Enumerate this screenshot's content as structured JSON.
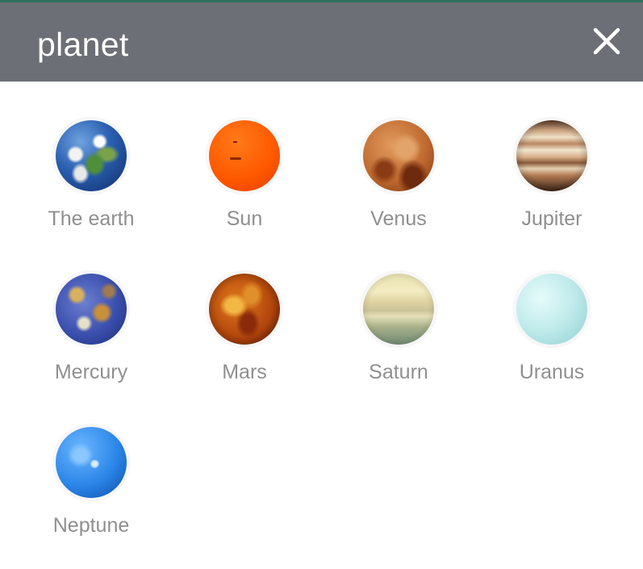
{
  "dialog": {
    "title": "planet",
    "close_icon": "close-icon"
  },
  "planets": [
    {
      "label": "The earth",
      "icon": "earth-icon"
    },
    {
      "label": "Sun",
      "icon": "sun-icon"
    },
    {
      "label": "Venus",
      "icon": "venus-icon"
    },
    {
      "label": "Jupiter",
      "icon": "jupiter-icon"
    },
    {
      "label": "Mercury",
      "icon": "mercury-icon"
    },
    {
      "label": "Mars",
      "icon": "mars-icon"
    },
    {
      "label": "Saturn",
      "icon": "saturn-icon"
    },
    {
      "label": "Uranus",
      "icon": "uranus-icon"
    },
    {
      "label": "Neptune",
      "icon": "neptune-icon"
    }
  ],
  "colors": {
    "header_background": "#6d6f76",
    "header_text": "#ffffff",
    "label_text": "#8f8f8f"
  }
}
